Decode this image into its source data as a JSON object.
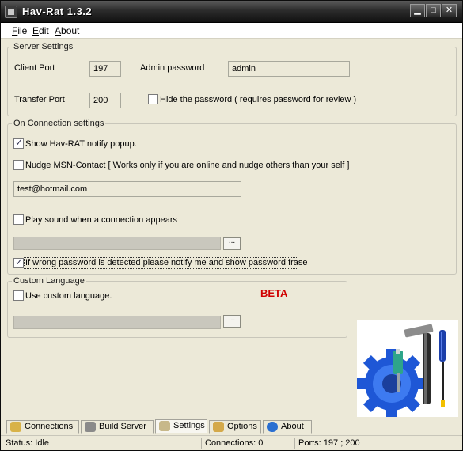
{
  "window": {
    "title": "Hav-Rat 1.3.2",
    "controls": [
      "minimize",
      "maximize",
      "close"
    ]
  },
  "menu": {
    "items": [
      {
        "label": "File",
        "accel": "F",
        "rest": "ile"
      },
      {
        "label": "Edit",
        "accel": "E",
        "rest": "dit"
      },
      {
        "label": "About",
        "accel": "A",
        "rest": "bout"
      }
    ]
  },
  "server_settings": {
    "title": "Server Settings",
    "client_port_label": "Client Port",
    "client_port_value": "197",
    "admin_password_label": "Admin password",
    "admin_password_value": "admin",
    "transfer_port_label": "Transfer Port",
    "transfer_port_value": "200",
    "hide_password_label": "Hide the password ( requires password for review )",
    "hide_password_checked": false
  },
  "connection_settings": {
    "title": "On Connection settings",
    "notify_popup_label": "Show Hav-RAT notify popup.",
    "notify_popup_checked": true,
    "nudge_msn_label": "Nudge MSN-Contact [ Works only if you are online and nudge others than your self ]",
    "nudge_msn_checked": false,
    "msn_email_value": "test@hotmail.com",
    "play_sound_label": "Play sound when a connection appears",
    "play_sound_checked": false,
    "sound_path_value": "",
    "browse_label": "...",
    "wrong_password_label": "If wrong password is detected please notify me and show password frase",
    "wrong_password_checked": true
  },
  "custom_language": {
    "title": "Custom Language",
    "use_custom_label": "Use custom language.",
    "use_custom_checked": false,
    "language_path_value": "",
    "browse_label": "...",
    "beta_label": "BETA",
    "beta_color": "#d00000"
  },
  "tabs": [
    {
      "label": "Connections",
      "icon": "users-icon",
      "active": false
    },
    {
      "label": "Build Server",
      "icon": "wrench-icon",
      "active": false
    },
    {
      "label": "Settings",
      "icon": "pen-icon",
      "active": true
    },
    {
      "label": "Options",
      "icon": "gears-icon",
      "active": false
    },
    {
      "label": "About",
      "icon": "info-icon",
      "active": false
    }
  ],
  "status": {
    "status_text": "Status: Idle",
    "connections_text": "Connections: 0",
    "ports_text": "Ports: 197 ; 200"
  }
}
